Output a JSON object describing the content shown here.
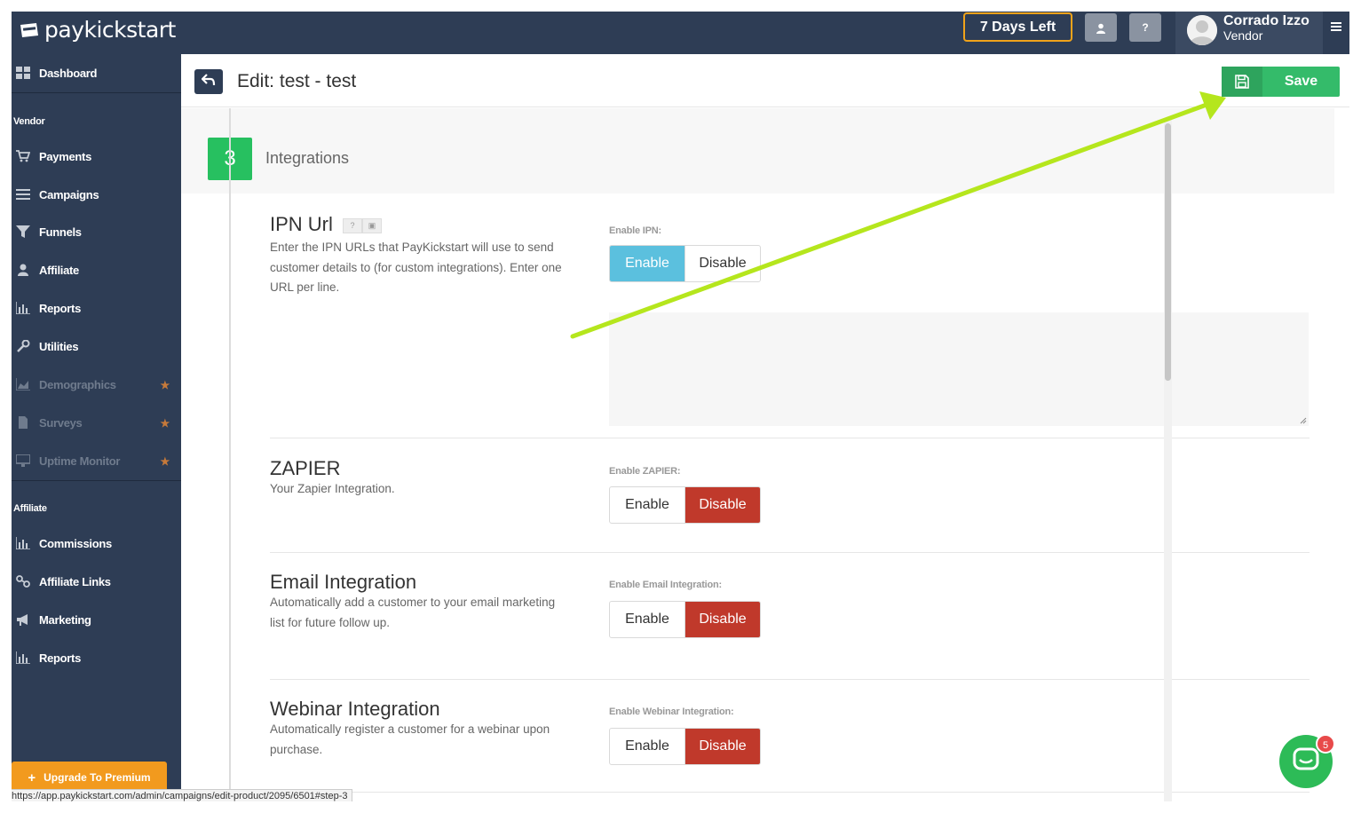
{
  "app": {
    "logo_text": "paykickstart"
  },
  "topbar": {
    "days_left": "7 Days Left",
    "user_icon": "user-icon",
    "help_label": "?",
    "user_name": "Corrado Izzo",
    "user_role": "Vendor"
  },
  "sidebar": {
    "dashboard": "Dashboard",
    "vendor_section": "Vendor",
    "vendor_items": [
      {
        "label": "Payments",
        "icon": "cart-icon"
      },
      {
        "label": "Campaigns",
        "icon": "list-icon"
      },
      {
        "label": "Funnels",
        "icon": "filter-icon"
      },
      {
        "label": "Affiliate",
        "icon": "user-icon"
      },
      {
        "label": "Reports",
        "icon": "bar-chart-icon"
      },
      {
        "label": "Utilities",
        "icon": "wrench-icon"
      },
      {
        "label": "Demographics",
        "icon": "area-chart-icon",
        "premium": true
      },
      {
        "label": "Surveys",
        "icon": "file-icon",
        "premium": true
      },
      {
        "label": "Uptime Monitor",
        "icon": "monitor-icon",
        "premium": true
      }
    ],
    "affiliate_section": "Affiliate",
    "affiliate_items": [
      {
        "label": "Commissions",
        "icon": "bar-chart-icon"
      },
      {
        "label": "Affiliate Links",
        "icon": "link-icon"
      },
      {
        "label": "Marketing",
        "icon": "bullhorn-icon"
      },
      {
        "label": "Reports",
        "icon": "bar-chart-icon"
      }
    ],
    "upgrade": "Upgrade To Premium"
  },
  "header": {
    "title": "Edit: test - test",
    "save_label": "Save"
  },
  "step": {
    "number": "3",
    "title": "Integrations"
  },
  "sections": {
    "ipn": {
      "title": "IPN Url",
      "desc": "Enter the IPN URLs that PayKickstart will use to send customer details to (for custom integrations). Enter one URL per line.",
      "label": "Enable IPN:",
      "enable": "Enable",
      "disable": "Disable",
      "state": "enabled",
      "textarea_value": ""
    },
    "zapier": {
      "title": "ZAPIER",
      "desc": "Your Zapier Integration.",
      "label": "Enable ZAPIER:",
      "enable": "Enable",
      "disable": "Disable",
      "state": "disabled"
    },
    "email": {
      "title": "Email Integration",
      "desc": "Automatically add a customer to your email marketing list for future follow up.",
      "label": "Enable Email Integration:",
      "enable": "Enable",
      "disable": "Disable",
      "state": "disabled"
    },
    "webinar": {
      "title": "Webinar Integration",
      "desc": "Automatically register a customer for a webinar upon purchase.",
      "label": "Enable Webinar Integration:",
      "enable": "Enable",
      "disable": "Disable",
      "state": "disabled"
    }
  },
  "chat": {
    "badge": "5"
  },
  "status_url": "https://app.paykickstart.com/admin/campaigns/edit-product/2095/6501#step-3",
  "colors": {
    "nav": "#2e3d55",
    "accent_green": "#34bb6a",
    "enable_blue": "#5bc0de",
    "disable_red": "#c0392b",
    "days_border": "#f0a31a",
    "upgrade": "#f29a1e",
    "arrow": "#b5e61d"
  }
}
